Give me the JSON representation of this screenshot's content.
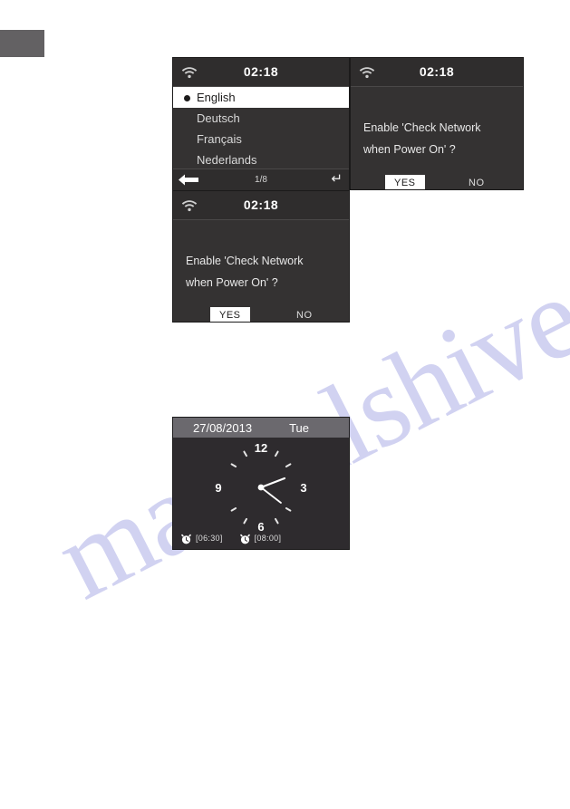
{
  "watermark": {
    "text": "manualshive.com"
  },
  "corner_tab": {
    "color": "#636163"
  },
  "panels": {
    "language_select": {
      "status": {
        "time": "02:18",
        "wifi_icon": "wifi-icon"
      },
      "items": [
        {
          "label": "English",
          "selected": true
        },
        {
          "label": "Deutsch",
          "selected": false
        },
        {
          "label": "Français",
          "selected": false
        },
        {
          "label": "Nederlands",
          "selected": false
        }
      ],
      "nav": {
        "back_icon": "left-arrow-icon",
        "page_indicator": "1/8",
        "enter_icon": "enter-return-icon",
        "enter_glyph": "↵"
      }
    },
    "confirm_right": {
      "status": {
        "time": "02:18",
        "wifi_icon": "wifi-icon"
      },
      "message_line1": "Enable 'Check Network",
      "message_line2": "when Power On' ?",
      "yes_label": "YES",
      "no_label": "NO",
      "selected": "YES"
    },
    "confirm_lower": {
      "status": {
        "time": "02:18",
        "wifi_icon": "wifi-icon"
      },
      "message_line1": "Enable 'Check Network",
      "message_line2": "when Power On' ?",
      "yes_label": "YES",
      "no_label": "NO",
      "selected": "YES"
    },
    "clock_display": {
      "date": "27/08/2013",
      "weekday": "Tue",
      "hour_markers": {
        "twelve": "12",
        "three": "3",
        "six": "6",
        "nine": "9"
      },
      "alarms": [
        {
          "icon": "alarm-clock-icon",
          "time": "[06:30]"
        },
        {
          "icon": "alarm-clock-icon",
          "time": "[08:00]"
        }
      ]
    }
  },
  "colors": {
    "screen_bg": "#343232",
    "statusbar_bg": "#2f2d2d",
    "highlight_bg": "#ffffff",
    "date_bar_bg": "#6b696e",
    "watermark": "#c9cbef"
  }
}
